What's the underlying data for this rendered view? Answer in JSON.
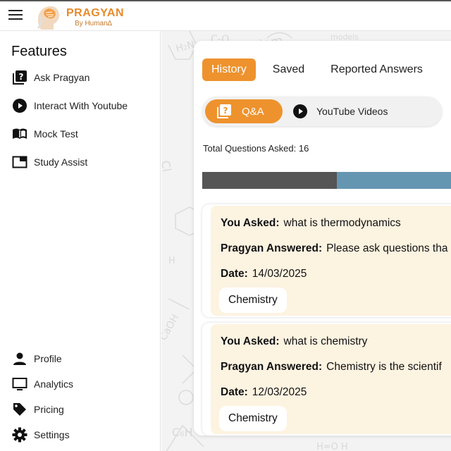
{
  "brand": {
    "name": "PRAGYAN",
    "tagline": "By Human∆"
  },
  "sidebar": {
    "heading": "Features",
    "features": [
      {
        "label": "Ask Pragyan",
        "icon": "question-book-icon"
      },
      {
        "label": "Interact With Youtube",
        "icon": "play-circle-icon"
      },
      {
        "label": "Mock Test",
        "icon": "open-book-icon"
      },
      {
        "label": "Study Assist",
        "icon": "window-icon"
      }
    ],
    "bottom": [
      {
        "label": "Profile",
        "icon": "person-icon"
      },
      {
        "label": "Analytics",
        "icon": "monitor-icon"
      },
      {
        "label": "Pricing",
        "icon": "tag-icon"
      },
      {
        "label": "Settings",
        "icon": "gear-icon"
      }
    ]
  },
  "tabs": [
    "History",
    "Saved",
    "Reported Answers"
  ],
  "active_tab": "History",
  "subtabs": {
    "qa": "Q&A",
    "youtube": "YouTube Videos"
  },
  "stats": {
    "total_questions_label": "Total Questions Asked: 16",
    "progress_fraction": 0.52
  },
  "qa_labels": {
    "asked": "You Asked:",
    "answered": "Pragyan Answered:",
    "date": "Date:"
  },
  "history": [
    {
      "question": "what is thermodynamics",
      "answer": "Please ask questions tha",
      "date": "14/03/2025",
      "subject": "Chemistry"
    },
    {
      "question": "what is chemistry",
      "answer": "Chemistry is the scientif",
      "date": "12/03/2025",
      "subject": "Chemistry"
    }
  ],
  "colors": {
    "accent": "#ee922d",
    "card_bg": "#fdf3e1",
    "bar_dark": "#555555",
    "bar_light": "#6596b1"
  }
}
